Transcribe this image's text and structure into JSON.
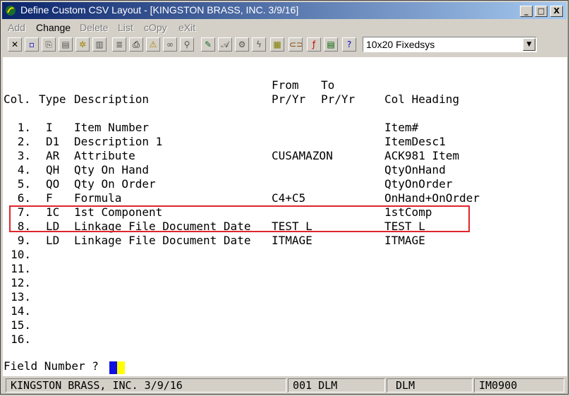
{
  "window": {
    "title": "Define Custom CSV Layout - [KINGSTON BRASS, INC. 3/9/16]",
    "controls": {
      "minimize": "_",
      "maximize": "□",
      "close": "X"
    }
  },
  "menu": [
    {
      "label": "Add",
      "enabled": false
    },
    {
      "label": "Change",
      "enabled": true
    },
    {
      "label": "Delete",
      "enabled": false
    },
    {
      "label": "List",
      "enabled": false
    },
    {
      "label": "cOpy",
      "enabled": false
    },
    {
      "label": "eXit",
      "enabled": false
    }
  ],
  "toolbar": {
    "font_select": "10x20 Fixedsys"
  },
  "table": {
    "header_from_to": {
      "from": "From",
      "to": "To"
    },
    "headers": {
      "col": "Col.",
      "type": "Type",
      "description": "Description",
      "from": "Pr/Yr",
      "to": "Pr/Yr",
      "heading": "Col Heading"
    },
    "rows": [
      {
        "col": "1.",
        "type": "I",
        "description": "Item Number",
        "from": "",
        "heading": "Item#"
      },
      {
        "col": "2.",
        "type": "D1",
        "description": "Description 1",
        "from": "",
        "heading": "ItemDesc1"
      },
      {
        "col": "3.",
        "type": "AR",
        "description": "Attribute",
        "from": "CUSAMAZON",
        "heading": "ACK981 Item"
      },
      {
        "col": "4.",
        "type": "QH",
        "description": "Qty On Hand",
        "from": "",
        "heading": "QtyOnHand"
      },
      {
        "col": "5.",
        "type": "QO",
        "description": "Qty On Order",
        "from": "",
        "heading": "QtyOnOrder"
      },
      {
        "col": "6.",
        "type": "F",
        "description": "Formula",
        "from": "C4+C5",
        "heading": "OnHand+OnOrder"
      },
      {
        "col": "7.",
        "type": "1C",
        "description": "1st Component",
        "from": "",
        "heading": "1stComp"
      },
      {
        "col": "8.",
        "type": "LD",
        "description": "Linkage File Document Date",
        "from": "TEST L",
        "heading": "TEST L"
      },
      {
        "col": "9.",
        "type": "LD",
        "description": "Linkage File Document Date",
        "from": "ITMAGE",
        "heading": "ITMAGE"
      },
      {
        "col": "10.",
        "type": "",
        "description": "",
        "from": "",
        "heading": ""
      },
      {
        "col": "11.",
        "type": "",
        "description": "",
        "from": "",
        "heading": ""
      },
      {
        "col": "12.",
        "type": "",
        "description": "",
        "from": "",
        "heading": ""
      },
      {
        "col": "13.",
        "type": "",
        "description": "",
        "from": "",
        "heading": ""
      },
      {
        "col": "14.",
        "type": "",
        "description": "",
        "from": "",
        "heading": ""
      },
      {
        "col": "15.",
        "type": "",
        "description": "",
        "from": "",
        "heading": ""
      },
      {
        "col": "16.",
        "type": "",
        "description": "",
        "from": "",
        "heading": ""
      }
    ]
  },
  "prompt": {
    "label": "Field Number ?"
  },
  "status": {
    "company": "KINGSTON BRASS, INC. 3/9/16",
    "code": "001 DLM",
    "user": "DLM",
    "program": "IM0900"
  },
  "colors": {
    "highlight": "#e0242c",
    "cursor": "#1010e0",
    "cursor_alt": "#ffff00"
  }
}
